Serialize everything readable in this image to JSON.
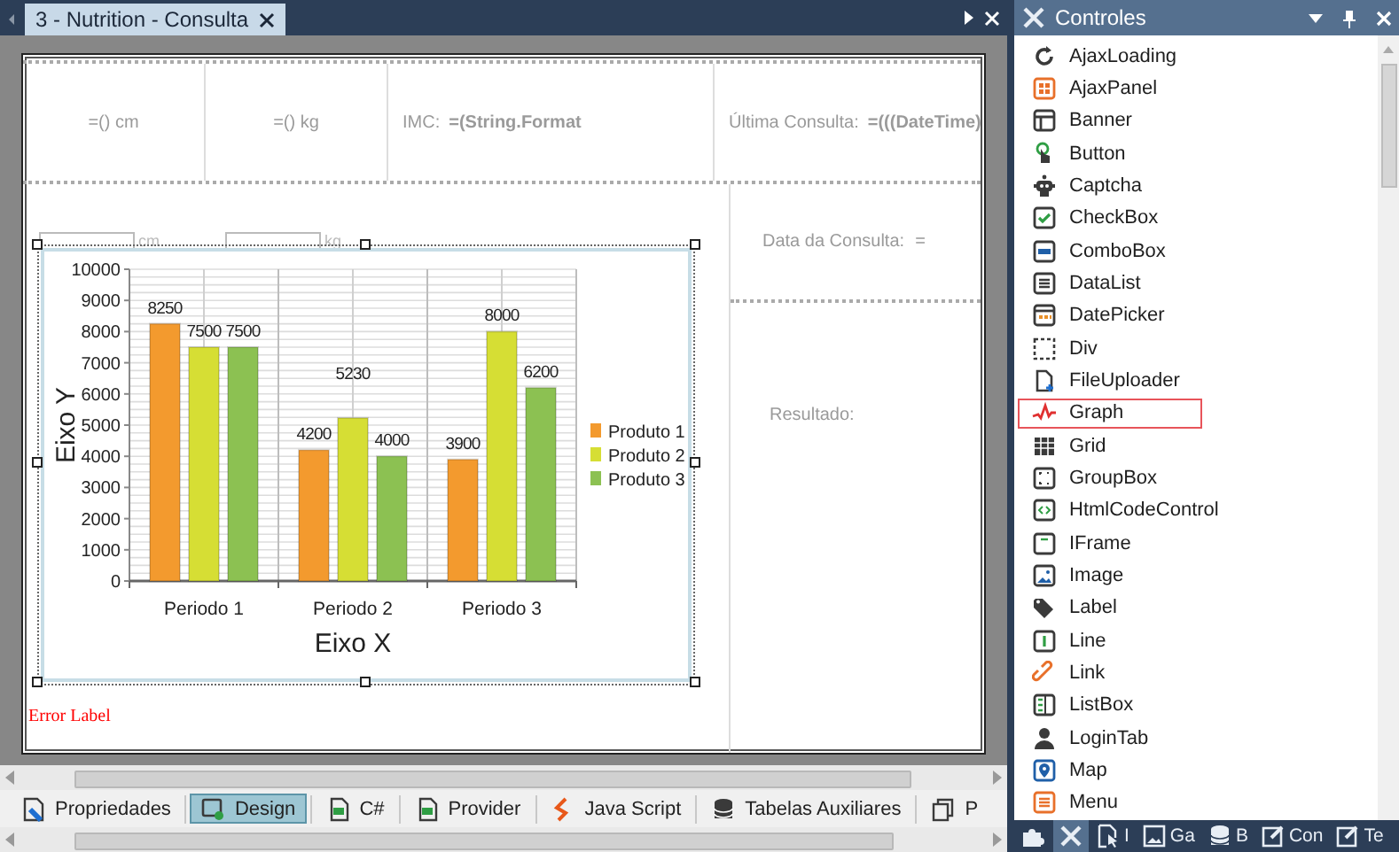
{
  "document_tab": {
    "title": "3 - Nutrition - Consulta"
  },
  "design_surface": {
    "header_cells": [
      {
        "value": "=() cm"
      },
      {
        "value": "=() kg"
      },
      {
        "label": "IMC:",
        "value": "=(String.Format"
      },
      {
        "label": "Última Consulta:",
        "value": "=(((DateTime)"
      }
    ],
    "inputs": [
      {
        "unit": "cm"
      },
      {
        "unit": "kg"
      }
    ],
    "data_consulta": {
      "label": "Data da Consulta:",
      "value": "="
    },
    "resultado_label": "Resultado:",
    "error_label": "Error Label",
    "chart": {
      "chart_data": {
        "type": "bar",
        "xlabel": "Eixo X",
        "ylabel": "Eixo Y",
        "categories": [
          "Periodo 1",
          "Periodo 2",
          "Periodo 3"
        ],
        "series": [
          {
            "name": "Produto 1",
            "color": "#f39a2e",
            "values": [
              8250,
              4200,
              3900
            ]
          },
          {
            "name": "Produto 2",
            "color": "#d6de34",
            "values": [
              7500,
              5230,
              8000
            ]
          },
          {
            "name": "Produto 3",
            "color": "#8cc152",
            "values": [
              7500,
              4000,
              6200
            ]
          }
        ],
        "grid": true,
        "legend": true,
        "ylim": [
          0,
          10000
        ],
        "yticks": [
          0,
          1000,
          2000,
          3000,
          4000,
          5000,
          6000,
          7000,
          8000,
          9000,
          10000
        ],
        "data_labels": true
      }
    }
  },
  "bottom_tabs": [
    {
      "label": "Propriedades",
      "selected": false
    },
    {
      "label": "Design",
      "selected": true
    },
    {
      "label": "C#",
      "selected": false
    },
    {
      "label": "Provider",
      "selected": false
    },
    {
      "label": "Java Script",
      "selected": false
    },
    {
      "label": "Tabelas Auxiliares",
      "selected": false
    },
    {
      "label": "P",
      "selected": false
    }
  ],
  "controls_panel": {
    "title": "Controles",
    "items": [
      {
        "label": "AjaxLoading",
        "selected": false
      },
      {
        "label": "AjaxPanel",
        "selected": false
      },
      {
        "label": "Banner",
        "selected": false
      },
      {
        "label": "Button",
        "selected": false
      },
      {
        "label": "Captcha",
        "selected": false
      },
      {
        "label": "CheckBox",
        "selected": false
      },
      {
        "label": "ComboBox",
        "selected": false
      },
      {
        "label": "DataList",
        "selected": false
      },
      {
        "label": "DatePicker",
        "selected": false
      },
      {
        "label": "Div",
        "selected": false
      },
      {
        "label": "FileUploader",
        "selected": false
      },
      {
        "label": "Graph",
        "selected": true
      },
      {
        "label": "Grid",
        "selected": false
      },
      {
        "label": "GroupBox",
        "selected": false
      },
      {
        "label": "HtmlCodeControl",
        "selected": false
      },
      {
        "label": "IFrame",
        "selected": false
      },
      {
        "label": "Image",
        "selected": false
      },
      {
        "label": "Label",
        "selected": false
      },
      {
        "label": "Line",
        "selected": false
      },
      {
        "label": "Link",
        "selected": false
      },
      {
        "label": "ListBox",
        "selected": false
      },
      {
        "label": "LoginTab",
        "selected": false
      },
      {
        "label": "Map",
        "selected": false
      },
      {
        "label": "Menu",
        "selected": false
      }
    ]
  },
  "bottom_toolbar": [
    {
      "selected": false
    },
    {
      "selected": true
    },
    {
      "label": "I",
      "selected": false
    },
    {
      "label": "Ga",
      "selected": false
    },
    {
      "label": "B",
      "selected": false
    },
    {
      "label": "Con",
      "selected": false
    },
    {
      "label": "Te",
      "selected": false
    }
  ]
}
